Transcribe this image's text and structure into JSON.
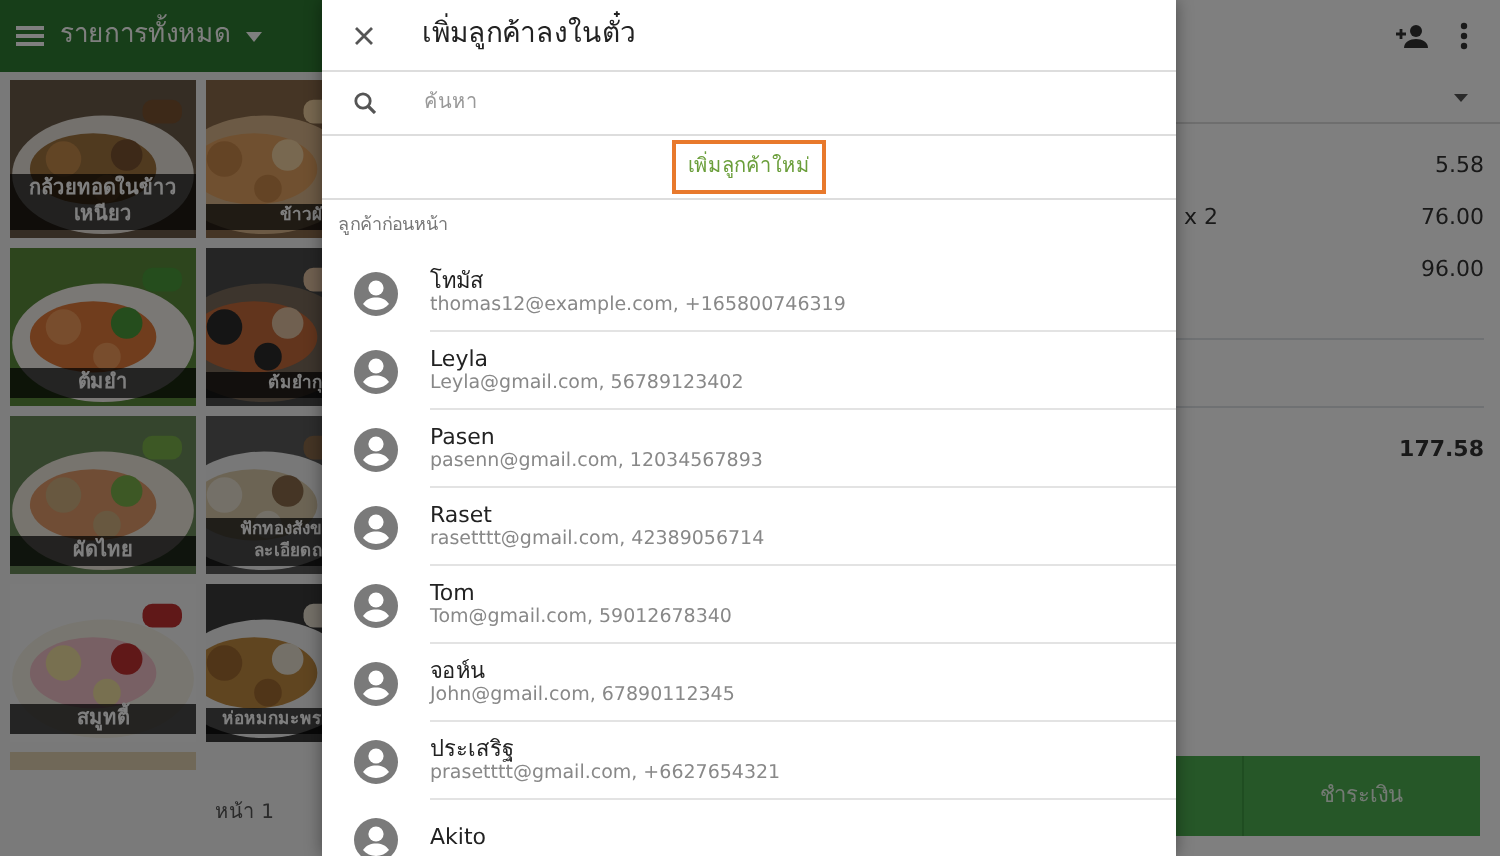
{
  "menu_panel": {
    "title": "รายการทั้งหมด",
    "page_label": "หน้า 1",
    "tiles": [
      {
        "lines": [
          "กล้วยทอดในข้าว",
          "เหนียว"
        ]
      },
      {
        "lines": [
          "ข้าวผั"
        ]
      },
      {
        "lines": [
          "ต้มยำ"
        ]
      },
      {
        "lines": [
          "ต้มยำกุ"
        ]
      },
      {
        "lines": [
          "ผัดไทย"
        ]
      },
      {
        "lines": [
          "ฟักทองสังข",
          "ละเอียดถ"
        ]
      },
      {
        "lines": [
          "สมูทตี้"
        ]
      },
      {
        "lines": [
          "ห่อหมกมะพร"
        ]
      }
    ]
  },
  "order_panel": {
    "rows": [
      {
        "amount": "5.58"
      },
      {
        "quantity": "x 2",
        "amount": "76.00"
      },
      {
        "amount": "96.00"
      }
    ],
    "total": "177.58",
    "pay_button": "ชำระเงิน"
  },
  "dialog": {
    "title": "เพิ่มลูกค้าลงในตั๋ว",
    "search": {
      "placeholder": "ค้นหา"
    },
    "new_customer_button": {
      "label": "เพิ่มลูกค้าใหม่",
      "highlighted": true
    },
    "section_label": "ลูกค้าก่อนหน้า",
    "customers": [
      {
        "name": "โทมัส",
        "detail": "thomas12@example.com, +165800746319"
      },
      {
        "name": "Leyla",
        "detail": "Leyla@gmail.com, 56789123402"
      },
      {
        "name": "Pasen",
        "detail": "pasenn@gmail.com, 12034567893"
      },
      {
        "name": "Raset",
        "detail": "rasetttt@gmail.com, 42389056714"
      },
      {
        "name": "Tom",
        "detail": "Tom@gmail.com, 59012678340"
      },
      {
        "name": "จอห์น",
        "detail": "John@gmail.com, 67890112345"
      },
      {
        "name": "ประเสริฐ",
        "detail": "prasetttt@gmail.com, +6627654321"
      },
      {
        "name": "Akito"
      }
    ]
  }
}
